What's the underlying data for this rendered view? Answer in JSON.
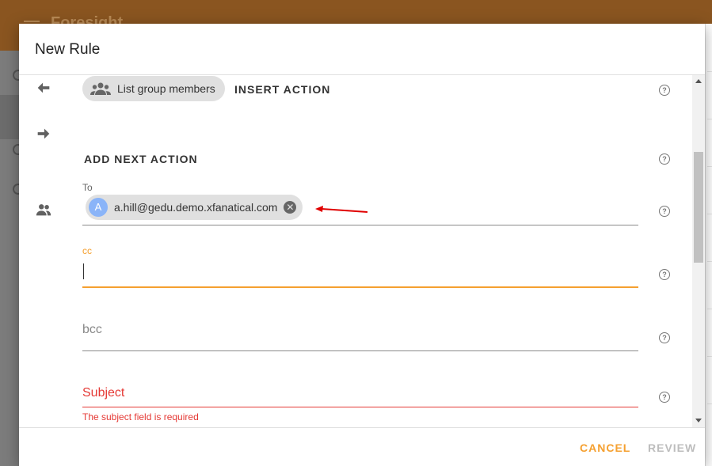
{
  "app": {
    "title": "Foresight"
  },
  "dialog": {
    "title": "New Rule",
    "actions": {
      "previous_chip": "List group members",
      "insert_action": "INSERT ACTION",
      "add_next_action": "ADD NEXT ACTION"
    },
    "to": {
      "label": "To",
      "recipient": {
        "avatar_letter": "A",
        "email": "a.hill@gedu.demo.xfanatical.com"
      }
    },
    "cc": {
      "label": "cc",
      "value": ""
    },
    "bcc": {
      "placeholder": "bcc"
    },
    "subject": {
      "placeholder": "Subject",
      "error": "The subject field is required"
    },
    "footer": {
      "cancel": "CANCEL",
      "review": "REVIEW"
    }
  },
  "icons": {
    "back": "arrow-left-icon",
    "next": "arrow-right-icon",
    "recipients": "people-icon",
    "group": "group-icon",
    "help": "help-circle-icon",
    "remove": "close-circle-icon",
    "annotation": "red-arrow-annotation"
  },
  "colors": {
    "accent": "#f5a030",
    "error": "#e53935",
    "appbar": "#8a5520",
    "annotation": "#e00000"
  }
}
